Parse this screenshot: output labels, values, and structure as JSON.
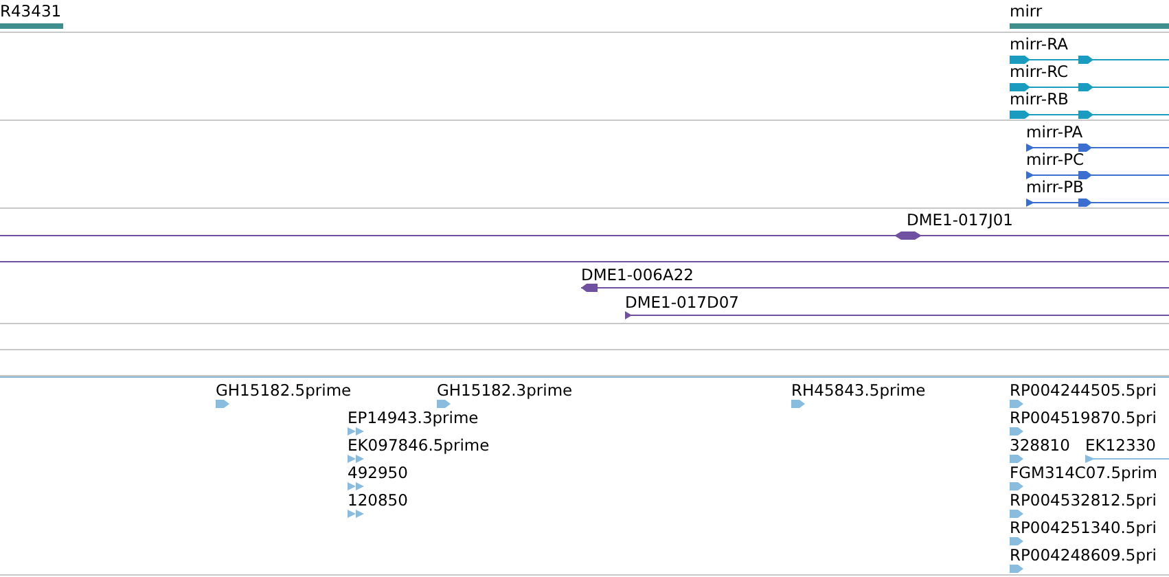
{
  "tracks": [
    {
      "kind": "gene",
      "features": [
        {
          "label": "R43431"
        },
        {
          "label": "mirr"
        }
      ]
    },
    {
      "kind": "transcript",
      "features": [
        {
          "label": "mirr-RA"
        },
        {
          "label": "mirr-RC"
        },
        {
          "label": "mirr-RB"
        }
      ]
    },
    {
      "kind": "protein",
      "features": [
        {
          "label": "mirr-PA"
        },
        {
          "label": "mirr-PC"
        },
        {
          "label": "mirr-PB"
        }
      ]
    },
    {
      "kind": "clone",
      "features": [
        {
          "label": "DME1-017J01"
        },
        {
          "label": "DME1-006A22"
        },
        {
          "label": "DME1-017D07"
        }
      ]
    },
    {
      "kind": "blank"
    },
    {
      "kind": "blank"
    },
    {
      "kind": "est",
      "features": [
        {
          "label": "GH15182.5prime"
        },
        {
          "label": "GH15182.3prime"
        },
        {
          "label": "EP14943.3prime"
        },
        {
          "label": "EK097846.5prime"
        },
        {
          "label": "492950"
        },
        {
          "label": "120850"
        },
        {
          "label": "RH45843.5prime"
        },
        {
          "label": "RP004244505.5pri"
        },
        {
          "label": "RP004519870.5pri"
        },
        {
          "label": "328810"
        },
        {
          "label": "EK12330"
        },
        {
          "label": "FGM314C07.5prim"
        },
        {
          "label": "RP004532812.5pri"
        },
        {
          "label": "RP004251340.5pri"
        },
        {
          "label": "RP004248609.5pri"
        }
      ]
    }
  ]
}
